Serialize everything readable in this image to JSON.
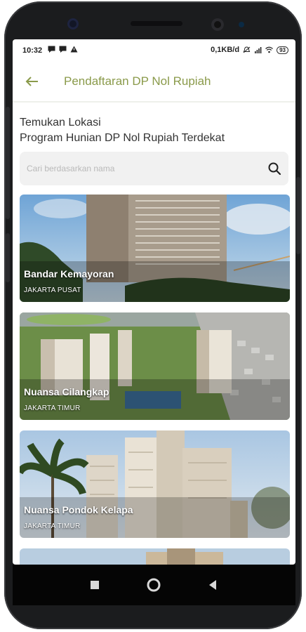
{
  "status_bar": {
    "time": "10:32",
    "network_speed": "0,1KB/d",
    "battery": "93"
  },
  "app_bar": {
    "title": "Pendaftaran DP Nol Rupiah"
  },
  "heading": {
    "line1": "Temukan Lokasi",
    "line2": "Program Hunian DP Nol Rupiah Terdekat"
  },
  "search": {
    "placeholder": "Cari berdasarkan nama"
  },
  "locations": [
    {
      "name": "Bandar Kemayoran",
      "area": "JAKARTA PUSAT"
    },
    {
      "name": "Nuansa Cilangkap",
      "area": "JAKARTA TIMUR"
    },
    {
      "name": "Nuansa Pondok Kelapa",
      "area": "JAKARTA TIMUR"
    }
  ],
  "colors": {
    "accent": "#8a9a4a",
    "phone_body": "#1b1c1e"
  }
}
